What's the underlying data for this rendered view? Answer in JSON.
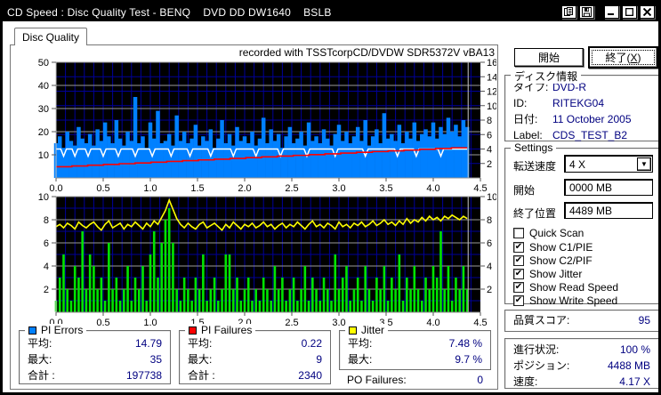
{
  "window": {
    "title": "CD Speed : Disc Quality Test - BENQ    DVD DD DW1640    BSLB"
  },
  "tab": {
    "label": "Disc Quality"
  },
  "recorded_note": "recorded with TSSTcorpCD/DVDW SDR5372V vBA13",
  "buttons": {
    "start": "開始",
    "exit_prefix": "終了(",
    "exit_mnemonic": "X",
    "exit_suffix": ")"
  },
  "disc_info": {
    "legend": "ディスク情報",
    "rows": [
      {
        "label": "タイプ:",
        "value": "DVD-R"
      },
      {
        "label": "ID:",
        "value": "RITEKG04"
      },
      {
        "label": "日付:",
        "value": "11 October 2005"
      },
      {
        "label": "Label:",
        "value": "CDS_TEST_B2"
      }
    ]
  },
  "settings": {
    "legend": "Settings",
    "speed_label": "転送速度",
    "speed_value": "4 X",
    "start_label": "開始",
    "start_value": "0000 MB",
    "end_label": "終了位置",
    "end_value": "4489 MB",
    "checkboxes": [
      {
        "label": "Quick Scan",
        "checked": false,
        "mark": ""
      },
      {
        "label": "Show C1/PIE",
        "checked": true,
        "mark": "✔"
      },
      {
        "label": "Show C2/PIF",
        "checked": true,
        "mark": "✔"
      },
      {
        "label": "Show Jitter",
        "checked": true,
        "mark": "✔"
      },
      {
        "label": "Show Read Speed",
        "checked": true,
        "mark": "✔"
      },
      {
        "label": "Show Write Speed",
        "checked": true,
        "mark": "✔"
      }
    ]
  },
  "quality": {
    "label": "品質スコア:",
    "value": "95"
  },
  "progress": {
    "rows": [
      {
        "label": "進行状況:",
        "value": "100 %"
      },
      {
        "label": "ポジション:",
        "value": "4488 MB"
      },
      {
        "label": "速度:",
        "value": "4.17 X"
      }
    ]
  },
  "stats": {
    "pi_errors": {
      "legend": "PI Errors",
      "color": "#0080FF",
      "rows": [
        {
          "label": "平均:",
          "value": "14.79"
        },
        {
          "label": "最大:",
          "value": "35"
        },
        {
          "label": "合計 :",
          "value": "197738"
        }
      ]
    },
    "pi_failures": {
      "legend": "PI Failures",
      "color": "#FF0000",
      "rows": [
        {
          "label": "平均:",
          "value": "0.22"
        },
        {
          "label": "最大:",
          "value": "9"
        },
        {
          "label": "合計 :",
          "value": "2340"
        }
      ]
    },
    "jitter": {
      "legend": "Jitter",
      "color": "#FFFF00",
      "rows": [
        {
          "label": "平均:",
          "value": "7.48 %"
        },
        {
          "label": "最大:",
          "value": "9.7 %"
        }
      ]
    }
  },
  "po_failures": {
    "label": "PO Failures:",
    "value": "0"
  },
  "colors": {
    "pi_area": "#0080FF",
    "pif_bars": "#00E400",
    "jitter_line": "#FFFF00",
    "write_speed_line": "#FFFFFF",
    "read_speed_line": "#FF0000",
    "grid_blue": "#000099",
    "grid_gray": "#9A9A9A",
    "plot_bg": "#000000",
    "value_text": "#000080"
  },
  "chart_data": [
    {
      "type": "area",
      "title": "PI Errors vs position (top chart)",
      "x_unit": "GB",
      "x_max": 4.5,
      "data_end_x": 4.37,
      "x_ticks": [
        "0.0",
        "0.5",
        "1.0",
        "1.5",
        "2.0",
        "2.5",
        "3.0",
        "3.5",
        "4.0",
        "4.5"
      ],
      "left_axis": {
        "min": 0,
        "max": 50,
        "ticks": [
          10,
          20,
          30,
          40,
          50
        ]
      },
      "right_axis": {
        "min": 0,
        "max": 16,
        "ticks": [
          2,
          4,
          6,
          8,
          10,
          12,
          14,
          16
        ]
      },
      "h_blue": {
        "axis": "right",
        "values": [
          2,
          4,
          6,
          8,
          10,
          12,
          14,
          16
        ]
      },
      "h_gray": {
        "axis": "left",
        "values": [
          10,
          20,
          30,
          40,
          50
        ]
      },
      "series": [
        {
          "name": "PI Errors",
          "type": "area",
          "axis": "left",
          "color": "#0080FF",
          "x_step": 0.04,
          "values": [
            15,
            18,
            13,
            20,
            16,
            14,
            22,
            17,
            15,
            19,
            14,
            21,
            16,
            24,
            18,
            15,
            25,
            17,
            14,
            20,
            16,
            35,
            15,
            18,
            13,
            24,
            17,
            29,
            15,
            16,
            19,
            14,
            27,
            16,
            20,
            15,
            17,
            23,
            14,
            18,
            16,
            21,
            13,
            17,
            25,
            15,
            19,
            14,
            22,
            16,
            18,
            15,
            20,
            14,
            17,
            26,
            15,
            21,
            16,
            19,
            13,
            18,
            22,
            15,
            17,
            20,
            14,
            24,
            16,
            18,
            15,
            21,
            17,
            14,
            19,
            23,
            16,
            20,
            15,
            18,
            22,
            16,
            25,
            14,
            18,
            21,
            15,
            28,
            17,
            19,
            16,
            23,
            15,
            20,
            17,
            24,
            16,
            19,
            21,
            18,
            24,
            17,
            22,
            19,
            26,
            20,
            23,
            18,
            25,
            22
          ]
        },
        {
          "name": "Write Speed",
          "type": "baseline_dips",
          "axis": "right",
          "color": "#FFFFFF",
          "base": 4.0,
          "dip_depth": 1.0,
          "dips": [
            0.08,
            0.2,
            0.34,
            0.5,
            0.66,
            0.84,
            1.02,
            1.22,
            1.42,
            1.64,
            1.88,
            2.12,
            2.38,
            2.66,
            2.96,
            3.28,
            3.62,
            3.82,
            4.08
          ]
        },
        {
          "name": "Read Speed",
          "type": "steps",
          "axis": "right",
          "color": "#FF0000",
          "start": 1.55,
          "end": 4.17,
          "steps": 26
        }
      ]
    },
    {
      "type": "bar",
      "title": "PI Failures and Jitter vs position (bottom chart)",
      "x_unit": "GB",
      "x_max": 4.5,
      "data_end_x": 4.37,
      "x_ticks": [
        "0.0",
        "0.5",
        "1.0",
        "1.5",
        "2.0",
        "2.5",
        "3.0",
        "3.5",
        "4.0",
        "4.5"
      ],
      "left_axis": {
        "min": 0,
        "max": 10,
        "ticks": [
          2,
          4,
          6,
          8,
          10
        ]
      },
      "right_axis": {
        "min": 0,
        "max": 10,
        "ticks": [
          2,
          4,
          6,
          8,
          10
        ]
      },
      "h_blue": {
        "axis": "left",
        "values": [
          1,
          3,
          5,
          7,
          9
        ]
      },
      "h_gray": {
        "axis": "left",
        "values": [
          2,
          4,
          6,
          8,
          10
        ]
      },
      "series": [
        {
          "name": "PI Failures",
          "type": "bars",
          "axis": "left",
          "color": "#00E400",
          "x_step": 0.04,
          "values": [
            1,
            3,
            5,
            2,
            1,
            4,
            3,
            7,
            2,
            5,
            4,
            2,
            3,
            1,
            6,
            2,
            3,
            1,
            2,
            4,
            1,
            3,
            2,
            4,
            1,
            5,
            7,
            3,
            6,
            8,
            9,
            6,
            2,
            1,
            3,
            2,
            1,
            3,
            2,
            5,
            1,
            2,
            3,
            1,
            2,
            5,
            5,
            2,
            3,
            1,
            2,
            3,
            1,
            2,
            1,
            3,
            2,
            1,
            4,
            2,
            3,
            1,
            2,
            3,
            1,
            2,
            4,
            1,
            3,
            2,
            1,
            3,
            2,
            1,
            5,
            2,
            3,
            4,
            1,
            2,
            3,
            1,
            4,
            2,
            1,
            3,
            2,
            4,
            1,
            3,
            2,
            5,
            1,
            3,
            2,
            4,
            2,
            1,
            3,
            2,
            4,
            3,
            7,
            2,
            4,
            1,
            3,
            2,
            4,
            2
          ]
        },
        {
          "name": "Jitter",
          "type": "line",
          "axis": "left",
          "color": "#FFFF00",
          "x_step": 0.04,
          "values": [
            7.4,
            7.6,
            7.3,
            7.7,
            7.5,
            7.2,
            7.8,
            7.5,
            7.3,
            7.6,
            7.8,
            7.4,
            7.1,
            7.6,
            7.9,
            7.3,
            7.5,
            7.7,
            7.2,
            7.6,
            7.4,
            7.8,
            7.5,
            7.2,
            7.7,
            7.4,
            7.9,
            7.6,
            8.2,
            8.8,
            9.7,
            8.9,
            8.1,
            7.6,
            7.3,
            7.7,
            7.4,
            7.2,
            7.6,
            7.8,
            7.3,
            7.5,
            7.7,
            7.4,
            7.1,
            7.6,
            7.3,
            7.8,
            7.5,
            7.2,
            7.6,
            7.4,
            7.7,
            7.3,
            7.5,
            7.8,
            7.4,
            7.6,
            7.2,
            7.5,
            7.7,
            7.3,
            7.6,
            7.4,
            7.8,
            7.5,
            7.2,
            7.6,
            7.9,
            7.4,
            7.6,
            7.3,
            7.7,
            7.5,
            7.2,
            7.8,
            7.4,
            7.6,
            7.3,
            7.7,
            7.5,
            7.8,
            7.4,
            7.6,
            7.9,
            7.5,
            7.7,
            8.0,
            7.6,
            7.8,
            7.5,
            7.9,
            7.6,
            8.1,
            7.7,
            8.0,
            7.8,
            8.2,
            7.9,
            8.3,
            8.0,
            8.2,
            7.9,
            8.3,
            8.1,
            8.4,
            8.2,
            8.0,
            8.3,
            8.1
          ]
        }
      ]
    }
  ]
}
